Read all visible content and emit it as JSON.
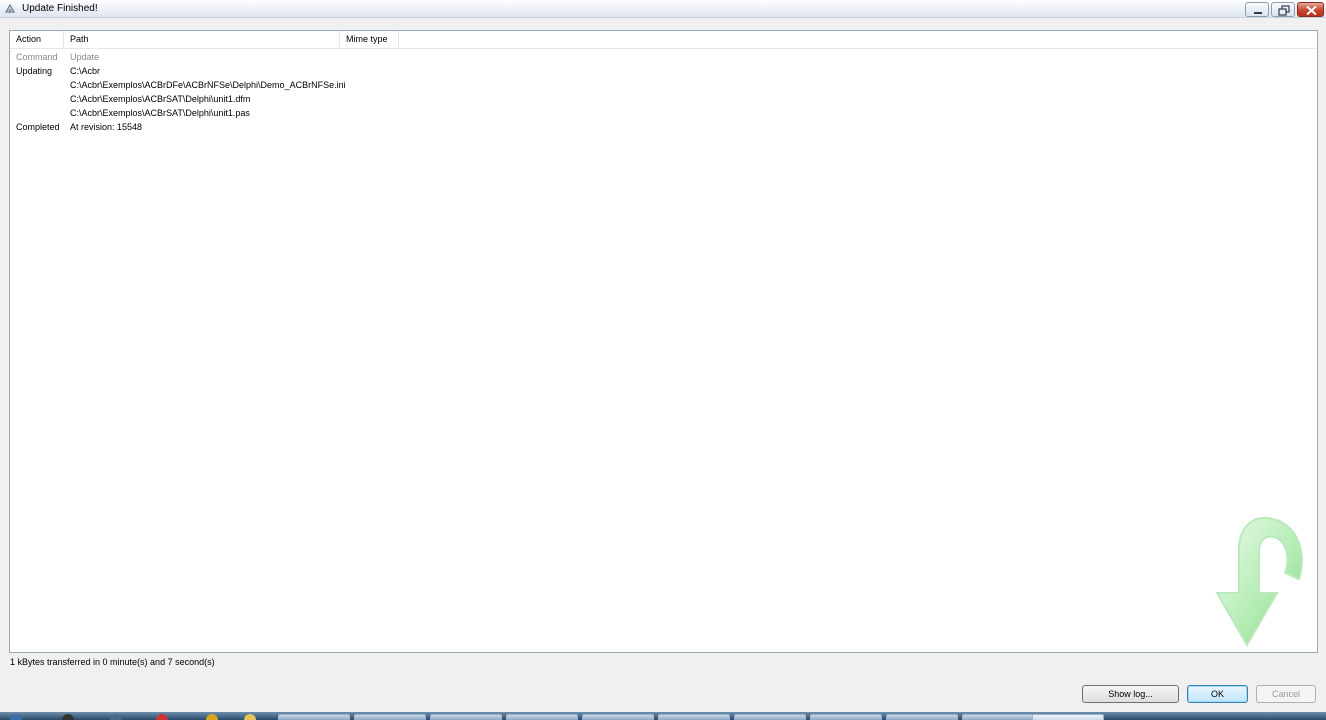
{
  "window": {
    "title": "Update Finished!"
  },
  "list": {
    "columns": [
      "Action",
      "Path",
      "Mime type"
    ],
    "rows": [
      {
        "action": "Command",
        "path": "Update",
        "dim": true
      },
      {
        "action": "Updating",
        "path": "C:\\Acbr",
        "dim": false
      },
      {
        "action": "",
        "path": "C:\\Acbr\\Exemplos\\ACBrDFe\\ACBrNFSe\\Delphi\\Demo_ACBrNFSe.ini",
        "dim": false
      },
      {
        "action": "",
        "path": "C:\\Acbr\\Exemplos\\ACBrSAT\\Delphi\\unit1.dfm",
        "dim": false
      },
      {
        "action": "",
        "path": "C:\\Acbr\\Exemplos\\ACBrSAT\\Delphi\\unit1.pas",
        "dim": false
      },
      {
        "action": "Completed",
        "path": "At revision: 15548",
        "dim": false
      }
    ]
  },
  "status": {
    "text": "1 kBytes transferred in 0 minute(s) and 7 second(s)"
  },
  "buttons": {
    "show_log": "Show log...",
    "ok": "OK",
    "cancel": "Cancel"
  },
  "icons": {
    "app": "tortoise-svn-icon",
    "logo": "green-curved-arrow-icon"
  },
  "colors": {
    "ok_border": "#3c7fb1",
    "logo_green": "#8ee08e"
  }
}
